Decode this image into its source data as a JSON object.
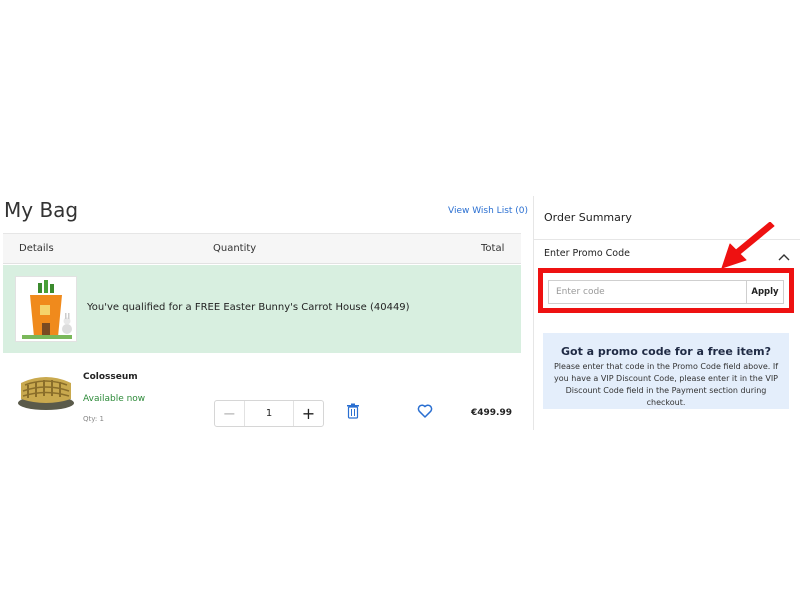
{
  "bag": {
    "title": "My Bag",
    "wishlist_link": "View Wish List (0)"
  },
  "table": {
    "headers": [
      "Details",
      "Quantity",
      "Total"
    ]
  },
  "promo_banner": {
    "text": "You've qualified for a FREE Easter Bunny's Carrot House (40449)"
  },
  "item": {
    "name": "Colosseum",
    "availability": "Available now",
    "qty_label": "Qty: 1",
    "quantity": "1",
    "minus_symbol": "−",
    "plus_symbol": "+",
    "price": "€499.99",
    "availability_color": "#2e8b3a"
  },
  "summary": {
    "title": "Order Summary",
    "promo_header": "Enter Promo Code",
    "promo_placeholder": "Enter code",
    "apply_label": "Apply"
  },
  "info": {
    "title": "Got a promo code for a free item?",
    "text": "Please enter that code in the Promo Code field above. If you have a VIP Discount Code, please enter it in the VIP Discount Code field in the Payment section during checkout."
  },
  "icons": {
    "delete": "trash-icon",
    "wishlist": "heart-icon",
    "collapse": "chevron-up-icon",
    "annotation": "red-arrow-icon"
  },
  "colors": {
    "link": "#2a6fd1",
    "promo_banner_bg": "#d8efe0",
    "info_box_bg": "#e4eefb",
    "highlight": "#ee1111"
  }
}
